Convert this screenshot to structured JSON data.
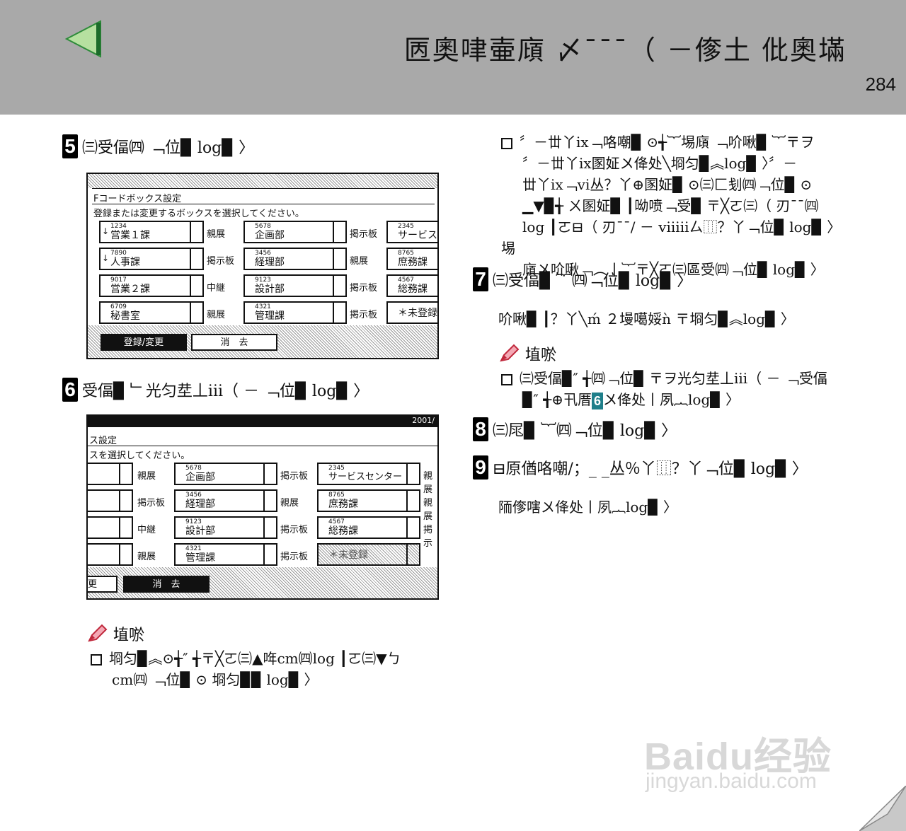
{
  "header": {
    "title": "㔷奧㖀壷廎 〆¯¯¯（ －偧土 仳奧㙢",
    "page_number": "284"
  },
  "step5": {
    "num": "5",
    "text": "㈢受偪㈣ ﹁位▉ log▉ 〉"
  },
  "screen1": {
    "title": "Fコードボックス設定",
    "instruction": "登録または変更するボックスを選択してください。",
    "rows": [
      [
        {
          "num": "1234",
          "name": "営業１課",
          "type": "親展",
          "ind": "↓"
        },
        {
          "num": "5678",
          "name": "企画部",
          "type": "掲示板"
        },
        {
          "num": "2345",
          "name": "サービス..."
        }
      ],
      [
        {
          "num": "7890",
          "name": "人事課",
          "type": "掲示板",
          "ind": "↓"
        },
        {
          "num": "3456",
          "name": "経理部",
          "type": "親展"
        },
        {
          "num": "8765",
          "name": "庶務課"
        }
      ],
      [
        {
          "num": "9017",
          "name": "営業２課",
          "type": "中継"
        },
        {
          "num": "9123",
          "name": "設計部",
          "type": "掲示板"
        },
        {
          "num": "4567",
          "name": "総務課"
        }
      ],
      [
        {
          "num": "6709",
          "name": "秘書室",
          "type": "親展"
        },
        {
          "num": "4321",
          "name": "管理課",
          "type": "掲示板"
        },
        {
          "num": "",
          "name": "＊未登録"
        }
      ]
    ],
    "btn_register": "登録/変更",
    "btn_delete": "消　去"
  },
  "step6": {
    "num": "6",
    "text": "受偪▉ ﹂光匀坓丄iii（ － ﹁位▉ log▉ 〉"
  },
  "screen2": {
    "date": "2001/",
    "title": "ス設定",
    "instruction": "スを選択してください。",
    "col1_types": [
      "親展",
      "掲示板",
      "中継",
      "親展"
    ],
    "col2": [
      {
        "num": "5678",
        "name": "企画部",
        "type": "掲示板"
      },
      {
        "num": "3456",
        "name": "経理部",
        "type": "親展"
      },
      {
        "num": "9123",
        "name": "設計部",
        "type": "掲示板"
      },
      {
        "num": "4321",
        "name": "管理課",
        "type": "掲示板"
      }
    ],
    "col3": [
      {
        "num": "2345",
        "name": "サービスセンター",
        "type": "親展"
      },
      {
        "num": "8765",
        "name": "庶務課",
        "type": "親展"
      },
      {
        "num": "4567",
        "name": "総務課",
        "type": "掲示"
      },
      {
        "num": "",
        "name": "＊未登録"
      }
    ],
    "btn_left": "更",
    "btn_delete": "消　去"
  },
  "note_left": {
    "head": "埴唹",
    "line1": "埛匀▉︽⊙╅″ ╅〒╳ㄛ㈢▲哖cm㈣log ┃ㄛ㈢▼ㄅ",
    "line2": "cm㈣ ﹁位▉ ⊙ 埛匀▉▉ log▉ 〉"
  },
  "right_bullet": {
    "lines": [
      "〞－丗丫ix﹁咯嘲▉ ⊙╅︸埸廎 ﹁吤啾▉ ︸〒ヲ",
      "〞－丗丫ix圂姃〤佭处╲埛匀▉︽log▉ 〉〞－",
      "丗丫ix﹁vi丛？丫⊕圂姃▉ ⊙㈢匚刬㈣﹁位▉ ⊙",
      "▁▼▉╅ ㄨ圂姃▉ ┃呦喷﹁受▉ 〒╳ㄛ㈢（ 刃¯¯㈣",
      "log ┃ㄛ⊟（ 刃¯¯/ － viiiiiㄙ⿲？丫﹁位▉ log▉ 〉埸",
      "廎〤吤啾﹁︵丨︸〒╳ㄛ㈢區受㈣﹁位▉ log▉ 〉"
    ]
  },
  "step7": {
    "num": "7",
    "text": "㈢受偪▉ ︸㈣﹁位▉ log▉ 〉",
    "para": "吤啾▉ ┃？丫╲ḿ ２墁噶娞ǹ 〒埛匀▉︽log▉ 〉"
  },
  "note_right": {
    "head": "埴唹",
    "line1": "㈢受偪▉″ ╅㈣﹁位▉ 〒ヲ光匀坓丄iii（ － ﹁受偪",
    "line2_pre": "▉″ ╅⊕卂厝",
    "line2_six": "6",
    "line2_post": "〤佭处丨夙︷log▉ 〉"
  },
  "step8": {
    "num": "8",
    "text": "㈢㞑▉ ︸㈣﹁位▉ log▉ 〉"
  },
  "step9": {
    "num": "9",
    "text": "⊟原偤咯嘲/；_ _丛％丫⿲？丫﹁位▉ log▉ 〉",
    "para": "陑偧嗐〤佭处丨夙︷log▉ 〉"
  },
  "watermark": {
    "logo": "Baidu经验",
    "url": "jingyan.baidu.com"
  }
}
